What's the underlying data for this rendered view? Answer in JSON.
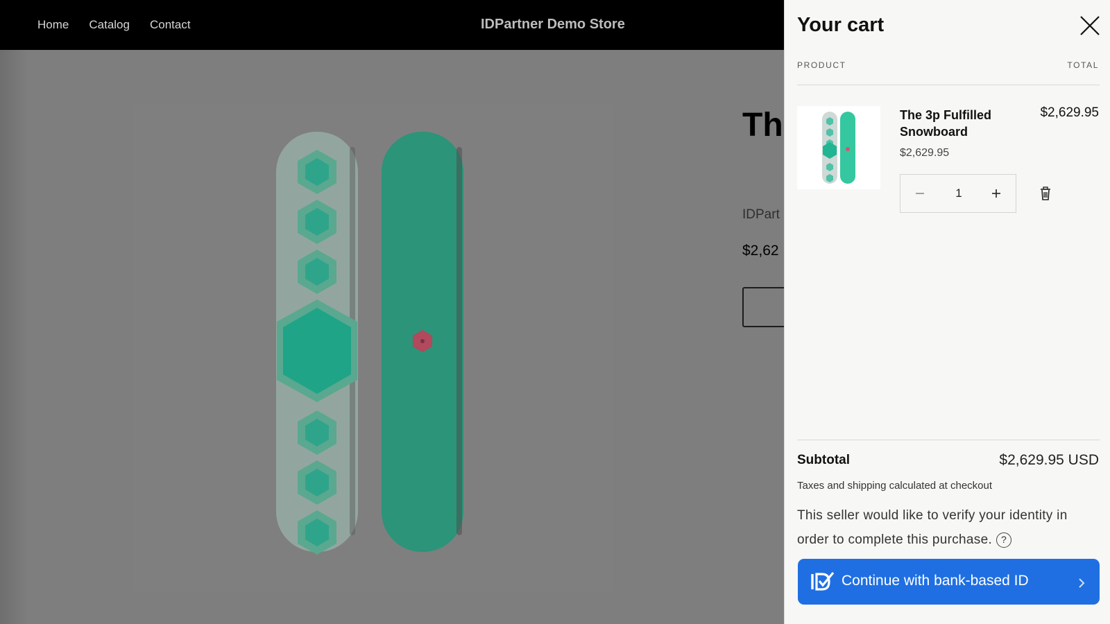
{
  "header": {
    "nav": [
      "Home",
      "Catalog",
      "Contact"
    ],
    "store_name": "IDPartner Demo Store"
  },
  "product_page": {
    "title_partial": "Th Sn",
    "vendor_partial": "IDPart",
    "price_partial": "$2,62",
    "image_alt_icon": "snowboard-image"
  },
  "cart": {
    "title": "Your cart",
    "col_product": "PRODUCT",
    "col_total": "TOTAL",
    "item": {
      "name": "The 3p Fulfilled Snowboard",
      "price": "$2,629.95",
      "total": "$2,629.95",
      "quantity": "1"
    },
    "subtotal_label": "Subtotal",
    "subtotal_value": "$2,629.95 USD",
    "tax_note": "Taxes and shipping calculated at checkout",
    "verify_text": "This seller would like to verify your identity in order to complete this purchase.",
    "help_glyph": "?",
    "cta_label": "Continue with bank-based ID"
  },
  "colors": {
    "header_bg": "#000000",
    "overlay": "#808080",
    "drawer_bg": "#f7f7f5",
    "cta": "#1f6fe3",
    "board_teal": "#2fb394",
    "board_accent": "#d6546b"
  }
}
